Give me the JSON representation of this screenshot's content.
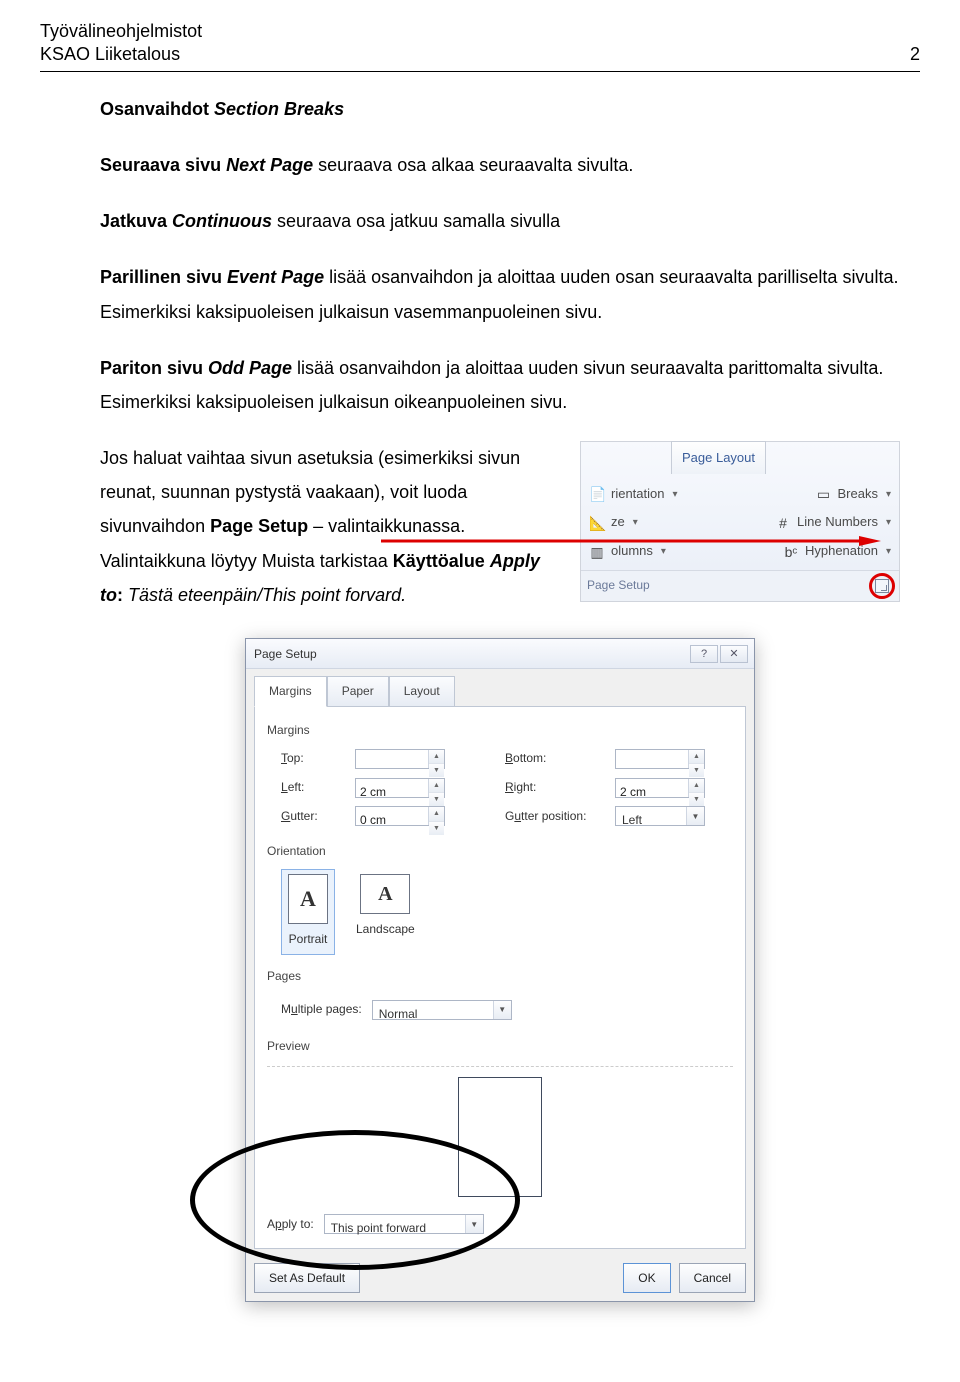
{
  "header": {
    "left1": "Työvälineohjelmistot",
    "left2": "KSAO Liiketalous",
    "right": "2"
  },
  "title": {
    "t1": "Osanvaihdot ",
    "t2": "Section Breaks"
  },
  "p1": {
    "a": "Seuraava sivu ",
    "b": "Next Page",
    "c": " seuraava osa alkaa seuraavalta sivulta."
  },
  "p2": {
    "a": "Jatkuva ",
    "b": "Continuous",
    "c": " seuraava osa jatkuu samalla sivulla"
  },
  "p3": {
    "a": "Parillinen sivu ",
    "b": "Event Page",
    "c": " lisää osanvaihdon ja aloittaa uuden osan seuraavalta parilliselta sivulta. Esimerkiksi kaksipuoleisen julkaisun vasemmanpuoleinen sivu."
  },
  "p4": {
    "a": "Pariton sivu ",
    "b": "Odd Page",
    "c": " lisää osanvaihdon ja aloittaa uuden sivun seuraavalta parittomalta sivulta. Esimerkiksi kaksipuoleisen julkaisun oikeanpuoleinen sivu."
  },
  "p5": {
    "a": "Jos haluat vaihtaa sivun asetuksia (esimerkiksi sivun reunat, suunnan pystystä vaakaan), voit luoda sivunvaihdon ",
    "b": "Page Setup",
    "c": " – valintaikkunassa. Valintaikkuna löytyy Muista tarkistaa ",
    "d": "Käyttöalue ",
    "e": "Apply to",
    "f": ": ",
    "g": "Tästä eteenpäin/This point forvard."
  },
  "ribbon": {
    "tab": "Page Layout",
    "rows": {
      "r1a": "rientation",
      "r1b": "Breaks",
      "r2a": "ze",
      "r2b": "Line Numbers",
      "r3a": "olumns",
      "r3b": "Hyphenation"
    },
    "group": "Page Setup"
  },
  "dialog": {
    "title": "Page Setup",
    "tabs": [
      "Margins",
      "Paper",
      "Layout"
    ],
    "margins_label": "Margins",
    "rows": {
      "top": "Top:",
      "top_v": "",
      "bottom": "Bottom:",
      "bottom_v": "",
      "left": "Left:",
      "left_v": "2 cm",
      "right": "Right:",
      "right_v": "2 cm",
      "gutter": "Gutter:",
      "gutter_v": "0 cm",
      "gutterpos": "Gutter position:",
      "gutterpos_v": "Left"
    },
    "orientation_label": "Orientation",
    "orient": {
      "portrait": "Portrait",
      "landscape": "Landscape"
    },
    "pages_label": "Pages",
    "multiple_pages": "Multiple pages:",
    "multiple_pages_v": "Normal",
    "preview_label": "Preview",
    "apply_to": "pply to:",
    "apply_to_v": "This point forward",
    "buttons": {
      "default": "Set As Default",
      "ok": "OK",
      "cancel": "Cancel"
    },
    "win": {
      "help": "?",
      "close": "✕"
    }
  }
}
